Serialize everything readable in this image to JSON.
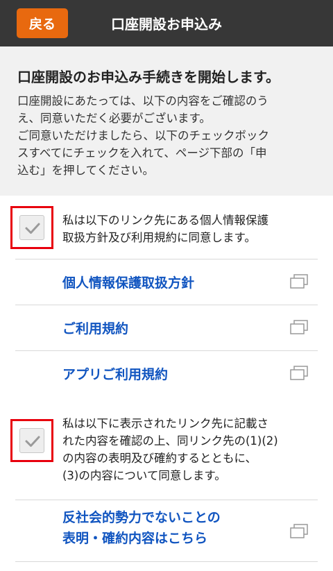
{
  "header": {
    "back_label": "戻る",
    "title": "口座開設お申込み"
  },
  "intro": {
    "heading": "口座開設のお申込み手続きを開始します。",
    "body_lines": [
      "口座開設にあたっては、以下の内容をご確認のう",
      "え、同意いただく必要がございます。",
      "ご同意いただけましたら、以下のチェックボック",
      "スすべてにチェックを入れて、ページ下部の「申",
      "込む」を押してください。"
    ]
  },
  "agreements": [
    {
      "text_lines": [
        "私は以下のリンク先にある個人情報保護",
        "取扱方針及び利用規約に同意します。"
      ],
      "checked": true
    },
    {
      "text_lines": [
        "私は以下に表示されたリンク先に記載さ",
        "れた内容を確認の上、同リンク先の(1)(2)",
        "の内容の表明及び確約するとともに、",
        "(3)の内容について同意します。"
      ],
      "checked": true
    }
  ],
  "links": [
    {
      "label": "個人情報保護取扱方針",
      "icon": "new-window-icon"
    },
    {
      "label": "ご利用規約",
      "icon": "new-window-icon"
    },
    {
      "label": "アプリご利用規約",
      "icon": "new-window-icon"
    },
    {
      "label_lines": [
        "反社会的勢力でないことの",
        "表明・確約内容はこちら"
      ],
      "icon": "new-window-icon"
    }
  ],
  "colors": {
    "header_bg": "#373737",
    "accent": "#e8690f",
    "link": "#1155c0",
    "highlight": "#e8000d"
  }
}
